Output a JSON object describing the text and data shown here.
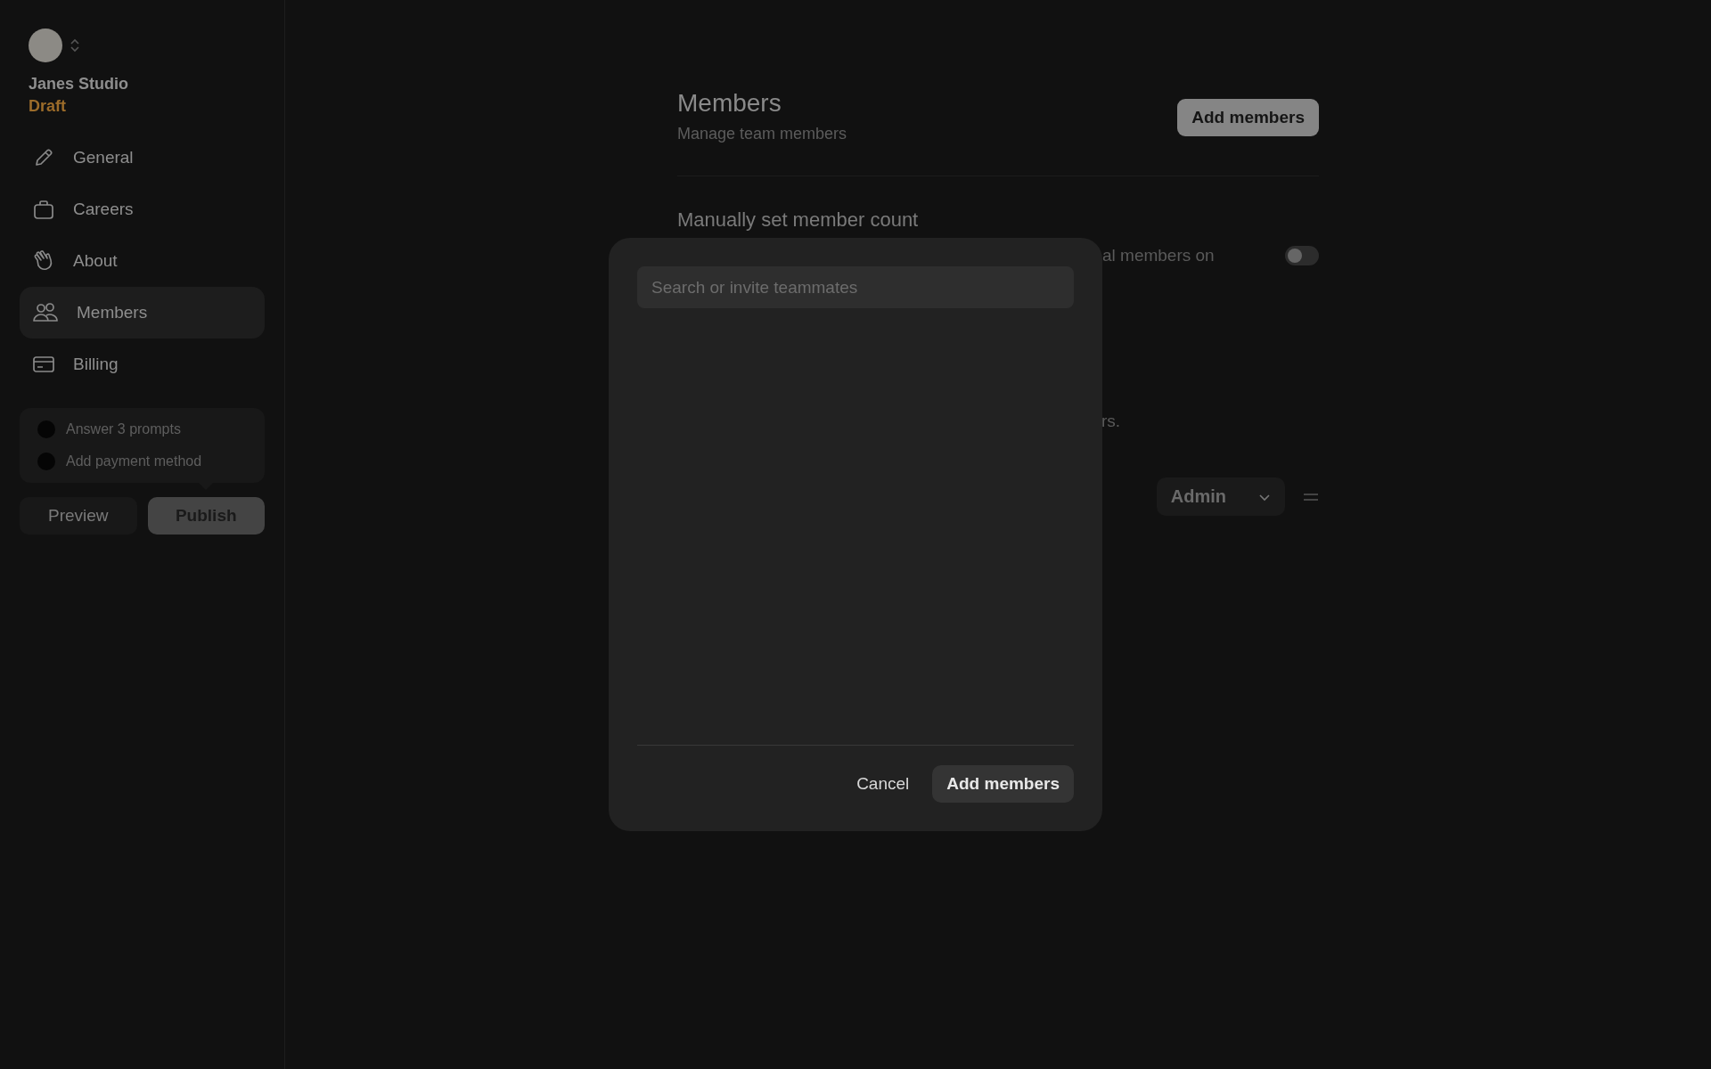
{
  "sidebar": {
    "workspace": {
      "name": "Janes Studio",
      "status": "Draft"
    },
    "nav": [
      {
        "label": "General",
        "kind": "pencil",
        "selected": false
      },
      {
        "label": "Careers",
        "kind": "briefcase",
        "selected": false
      },
      {
        "label": "About",
        "kind": "hand",
        "selected": false
      },
      {
        "label": "Members",
        "kind": "people",
        "selected": true
      },
      {
        "label": "Billing",
        "kind": "card",
        "selected": false
      }
    ],
    "checklist": [
      {
        "label": "Answer 3 prompts",
        "checked": false
      },
      {
        "label": "Add payment method",
        "checked": false
      }
    ],
    "preview_button": "Preview",
    "publish_button": "Publish"
  },
  "page": {
    "title": "Members",
    "subtitle": "Manage team members",
    "add_button": "Add members",
    "setting": {
      "title": "Manually set member count",
      "description": "al members on",
      "on": false
    },
    "note": "rs.",
    "member": {
      "role": "Admin"
    }
  },
  "modal": {
    "search": {
      "placeholder": "Search or invite teammates"
    },
    "cancel_button": "Cancel",
    "confirm_button": "Add members"
  }
}
